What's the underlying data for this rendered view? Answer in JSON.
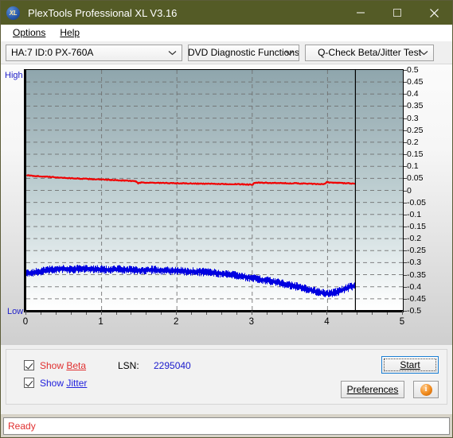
{
  "window": {
    "title": "PlexTools Professional XL V3.16",
    "icon": "xl-app-icon",
    "minimize": "minimize-icon",
    "maximize": "maximize-icon",
    "close": "close-icon"
  },
  "menubar": {
    "items": [
      {
        "label": "Options",
        "accel": "O"
      },
      {
        "label": "Help",
        "accel": "H"
      }
    ]
  },
  "toolbar": {
    "drive_select": "HA:7 ID:0  PX-760A",
    "function_select": "DVD Diagnostic Functions",
    "test_select": "Q-Check Beta/Jitter Test"
  },
  "chart_axis": {
    "high_label": "High",
    "low_label": "Low"
  },
  "controls": {
    "show_beta_label": "Show Beta",
    "show_beta_accel": "B",
    "show_beta_checked": true,
    "show_jitter_label": "Show Jitter",
    "show_jitter_accel": "J",
    "show_jitter_checked": true,
    "lsn_label": "LSN:",
    "lsn_value": "2295040",
    "start_label": "Start",
    "start_accel": "S",
    "preferences_label": "Preferences",
    "preferences_accel": "P",
    "info_label": "i"
  },
  "statusbar": {
    "text": "Ready"
  },
  "colors": {
    "titlebar": "#545b26",
    "beta": "#f00000",
    "jitter": "#0000e0",
    "axis_label": "#2020c8",
    "status": "#e03030",
    "accent": "#1b7fd4"
  },
  "chart_data": {
    "type": "line",
    "title": "Q-Check Beta/Jitter Test",
    "xlabel": "",
    "ylabel": "",
    "xlim": [
      0,
      5
    ],
    "ylim": [
      -0.5,
      0.5
    ],
    "xticks": [
      0,
      1,
      2,
      3,
      4,
      5
    ],
    "yticks": [
      0.5,
      0.45,
      0.4,
      0.35,
      0.3,
      0.25,
      0.2,
      0.15,
      0.1,
      0.05,
      0,
      -0.05,
      -0.1,
      -0.15,
      -0.2,
      -0.25,
      -0.3,
      -0.35,
      -0.4,
      -0.45,
      -0.5
    ],
    "ytick_labels": [
      "0.5",
      "0.45",
      "0.4",
      "0.35",
      "0.3",
      "0.25",
      "0.2",
      "0.15",
      "0.1",
      "0.05",
      "0",
      "-0.05",
      "-0.1",
      "-0.15",
      "-0.2",
      "-0.25",
      "-0.3",
      "-0.35",
      "-0.4",
      "-0.45",
      "-0.5"
    ],
    "xtick_labels": [
      "0",
      "1",
      "2",
      "3",
      "4",
      "5"
    ],
    "grid": true,
    "grid_style": "dashed",
    "data_end_x": 4.37,
    "marker_line_x": 4.37,
    "legend": [
      "Show Beta",
      "Show Jitter"
    ],
    "series": [
      {
        "name": "Beta",
        "color": "#f00000",
        "x": [
          0.0,
          0.1,
          0.25,
          0.4,
          0.55,
          0.7,
          0.85,
          1.0,
          1.15,
          1.3,
          1.45,
          1.48,
          1.52,
          1.7,
          1.9,
          2.1,
          2.3,
          2.5,
          2.7,
          2.9,
          3.0,
          3.02,
          3.2,
          3.4,
          3.6,
          3.8,
          3.95,
          3.98,
          4.02,
          4.15,
          4.3,
          4.37
        ],
        "values": [
          0.062,
          0.06,
          0.057,
          0.054,
          0.051,
          0.049,
          0.047,
          0.045,
          0.043,
          0.041,
          0.038,
          0.03,
          0.033,
          0.031,
          0.03,
          0.029,
          0.028,
          0.027,
          0.026,
          0.025,
          0.024,
          0.032,
          0.031,
          0.03,
          0.029,
          0.027,
          0.025,
          0.034,
          0.033,
          0.031,
          0.029,
          0.028
        ]
      },
      {
        "name": "Jitter",
        "color": "#0000e0",
        "x": [
          0.0,
          0.15,
          0.3,
          0.45,
          0.6,
          0.75,
          0.9,
          1.05,
          1.2,
          1.35,
          1.5,
          1.65,
          1.8,
          1.95,
          2.1,
          2.25,
          2.4,
          2.55,
          2.7,
          2.85,
          3.0,
          3.15,
          3.3,
          3.45,
          3.6,
          3.75,
          3.9,
          4.0,
          4.1,
          4.2,
          4.3,
          4.37
        ],
        "values": [
          -0.345,
          -0.338,
          -0.33,
          -0.326,
          -0.328,
          -0.325,
          -0.327,
          -0.33,
          -0.328,
          -0.33,
          -0.332,
          -0.33,
          -0.333,
          -0.334,
          -0.336,
          -0.338,
          -0.34,
          -0.344,
          -0.35,
          -0.357,
          -0.364,
          -0.372,
          -0.38,
          -0.39,
          -0.4,
          -0.412,
          -0.424,
          -0.43,
          -0.424,
          -0.412,
          -0.4,
          -0.396
        ],
        "noise_amplitude": 0.018,
        "note": "dense noisy band; values are band centers"
      }
    ]
  }
}
